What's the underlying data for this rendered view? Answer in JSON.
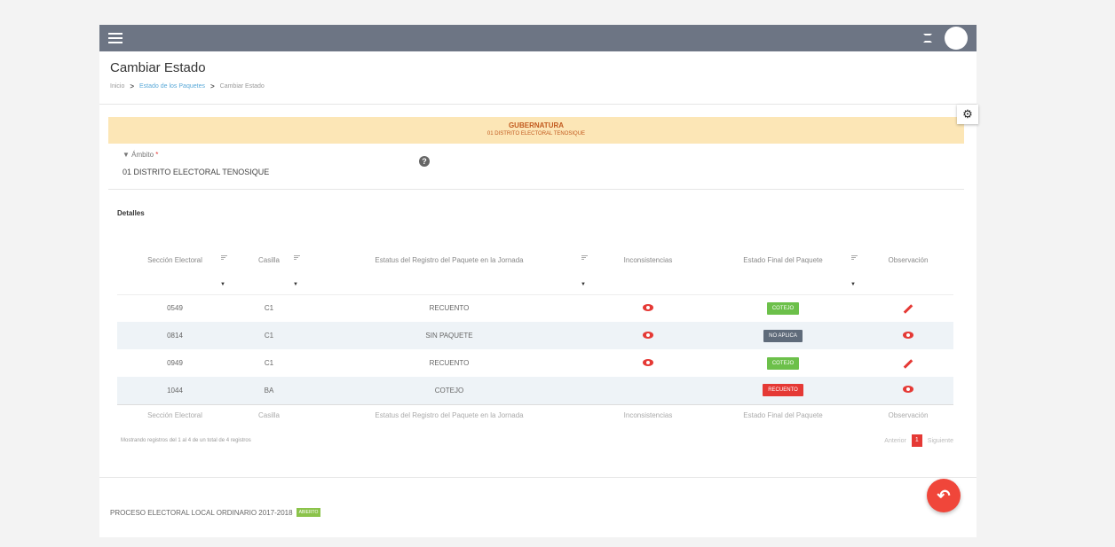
{
  "header": {
    "title": "Cambiar Estado"
  },
  "breadcrumb": {
    "home": "Inicio",
    "parent": "Estado de los Paquetes",
    "current": "Cambiar Estado"
  },
  "banner": {
    "title": "GUBERNATURA",
    "subtitle": "01 DISTRITO ELECTORAL TENOSIQUE"
  },
  "ambito": {
    "label": "Ámbito",
    "required": "*",
    "value": "01 DISTRITO ELECTORAL TENOSIQUE",
    "help": "?"
  },
  "details": {
    "title": "Detalles"
  },
  "table": {
    "columns": [
      "Sección Electoral",
      "Casilla",
      "Estatus del Registro del Paquete en la Jornada",
      "Inconsistencias",
      "Estado Final del Paquete",
      "Observación"
    ],
    "rows": [
      {
        "seccion": "0549",
        "casilla": "C1",
        "estatus": "RECUENTO",
        "estado": "COTEJO",
        "estado_color": "#6cc04a",
        "obs_icon": "pencil-icon"
      },
      {
        "seccion": "0814",
        "casilla": "C1",
        "estatus": "SIN PAQUETE",
        "estado": "NO APLICA",
        "estado_color": "#5f6b7a",
        "obs_icon": "eye-icon"
      },
      {
        "seccion": "0949",
        "casilla": "C1",
        "estatus": "RECUENTO",
        "estado": "COTEJO",
        "estado_color": "#6cc04a",
        "obs_icon": "pencil-icon"
      },
      {
        "seccion": "1044",
        "casilla": "BA",
        "estatus": "COTEJO",
        "estado": "RECUENTO",
        "estado_color": "#e53935",
        "obs_icon": "eye-icon"
      }
    ],
    "footer_columns": [
      "Sección Electoral",
      "Casilla",
      "Estatus del Registro del Paquete en la Jornada",
      "Inconsistencias",
      "Estado Final del Paquete",
      "Observación"
    ],
    "showing": "Mostrando registros del 1 al 4 de un total de 4 registros"
  },
  "pagination": {
    "prev": "Anterior",
    "page": "1",
    "next": "Siguiente"
  },
  "footer": {
    "process": "PROCESO ELECTORAL LOCAL ORDINARIO 2017-2018",
    "status": "ABIERTO"
  },
  "icons": {
    "settings": "gear-icon",
    "back": "reply-icon",
    "menu": "menu-icon",
    "fullscreen": "fullscreen-icon"
  }
}
